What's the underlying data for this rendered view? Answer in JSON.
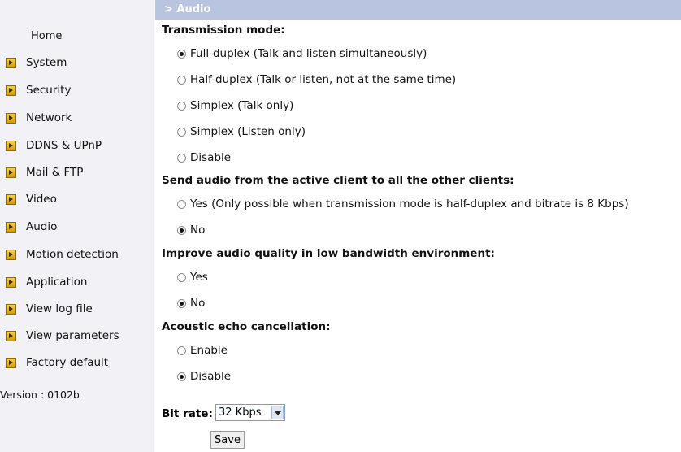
{
  "sidebar": {
    "home": "Home",
    "items": [
      {
        "label": "System"
      },
      {
        "label": "Security"
      },
      {
        "label": "Network"
      },
      {
        "label": "DDNS & UPnP"
      },
      {
        "label": "Mail & FTP"
      },
      {
        "label": "Video"
      },
      {
        "label": "Audio"
      },
      {
        "label": "Motion detection"
      },
      {
        "label": "Application"
      },
      {
        "label": "View log file"
      },
      {
        "label": "View parameters"
      },
      {
        "label": "Factory default"
      }
    ],
    "version": "Version : 0102b"
  },
  "main": {
    "title": "> Audio",
    "transmission": {
      "label": "Transmission mode:",
      "options": [
        {
          "label": "Full-duplex (Talk and listen simultaneously)",
          "selected": true
        },
        {
          "label": "Half-duplex (Talk or listen, not at the same time)",
          "selected": false
        },
        {
          "label": "Simplex (Talk only)",
          "selected": false
        },
        {
          "label": "Simplex (Listen only)",
          "selected": false
        },
        {
          "label": "Disable",
          "selected": false
        }
      ]
    },
    "send_audio": {
      "label": "Send audio from the active client to all the other clients:",
      "options": [
        {
          "label": "Yes (Only possible when transmission mode is half-duplex and bitrate is 8 Kbps)",
          "selected": false
        },
        {
          "label": "No",
          "selected": true
        }
      ]
    },
    "improve_quality": {
      "label": "Improve audio quality in low bandwidth environment:",
      "options": [
        {
          "label": "Yes",
          "selected": false
        },
        {
          "label": "No",
          "selected": true
        }
      ]
    },
    "echo": {
      "label": "Acoustic echo cancellation:",
      "options": [
        {
          "label": "Enable",
          "selected": false
        },
        {
          "label": "Disable",
          "selected": true
        }
      ]
    },
    "bitrate": {
      "label": "Bit rate:",
      "value": "32 Kbps"
    },
    "save_label": "Save"
  }
}
